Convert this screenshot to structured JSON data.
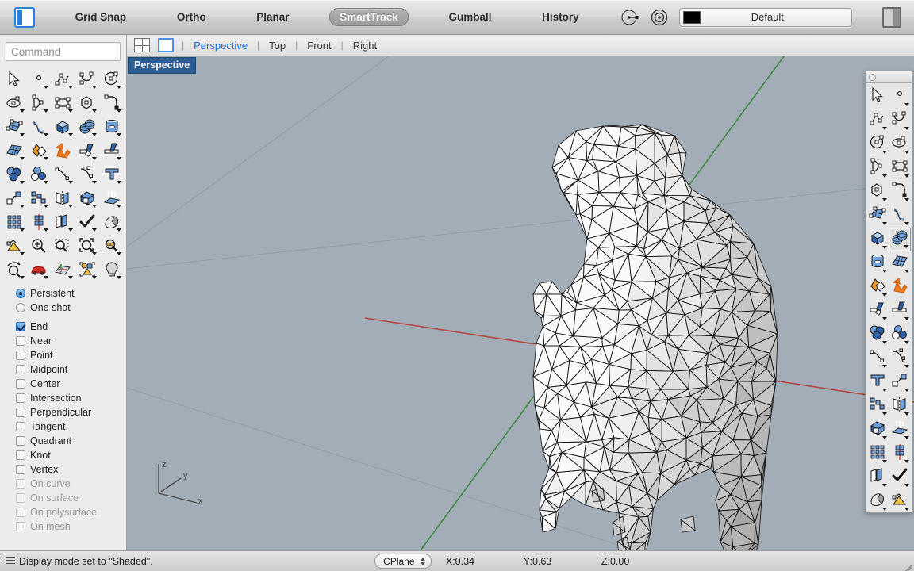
{
  "toolbar": {
    "panel_toggle_left_icon": "left-panel-icon",
    "modes": [
      {
        "label": "Grid Snap",
        "active": false
      },
      {
        "label": "Ortho",
        "active": false
      },
      {
        "label": "Planar",
        "active": false
      },
      {
        "label": "SmartTrack",
        "active": true
      },
      {
        "label": "Gumball",
        "active": false
      },
      {
        "label": "History",
        "active": false
      }
    ],
    "osnap_icon": "osnap-target-icon",
    "record_icon": "record-circle-icon",
    "layer": {
      "name": "Default",
      "swatch_color": "#000000"
    },
    "panel_toggle_right_icon": "right-panel-icon"
  },
  "viewtabs": {
    "four_view_icon": "four-viewport-icon",
    "single_view_icon": "single-viewport-icon",
    "separator": "|",
    "tabs": [
      {
        "label": "Perspective",
        "active": true
      },
      {
        "label": "Top",
        "active": false
      },
      {
        "label": "Front",
        "active": false
      },
      {
        "label": "Right",
        "active": false
      }
    ]
  },
  "command": {
    "value": "",
    "placeholder": "Command"
  },
  "tools": [
    {
      "name": "select-arrow-tool",
      "icon": "cursor-arrow-icon",
      "arrow": false
    },
    {
      "name": "point-tool",
      "icon": "point-icon",
      "arrow": true
    },
    {
      "name": "polyline-tool",
      "icon": "polyline-icon",
      "arrow": true
    },
    {
      "name": "curve-tool",
      "icon": "curve-icon",
      "arrow": true
    },
    {
      "name": "circle-tool",
      "icon": "circle-icon",
      "arrow": true
    },
    {
      "name": "ellipse-tool",
      "icon": "ellipse-icon",
      "arrow": true
    },
    {
      "name": "arc-tool",
      "icon": "arc-icon",
      "arrow": true
    },
    {
      "name": "rectangle-tool",
      "icon": "rectangle-icon",
      "arrow": true
    },
    {
      "name": "polygon-tool",
      "icon": "polygon-icon",
      "arrow": true
    },
    {
      "name": "fillet-curve-tool",
      "icon": "fillet-curve-icon",
      "arrow": true
    },
    {
      "name": "surface-from-curves-tool",
      "icon": "surface-patch-icon",
      "arrow": true
    },
    {
      "name": "extrude-surface-tool",
      "icon": "extrude-surface-icon",
      "arrow": true
    },
    {
      "name": "box-tool",
      "icon": "box-icon",
      "arrow": true
    },
    {
      "name": "sphere-tool",
      "icon": "sphere-icon",
      "arrow": true
    },
    {
      "name": "cylinder-tool",
      "icon": "cylinder-icon",
      "arrow": true
    },
    {
      "name": "mesh-plane-tool",
      "icon": "mesh-plane-icon",
      "arrow": true
    },
    {
      "name": "boolean-union-tool",
      "icon": "boolean-union-icon",
      "arrow": true
    },
    {
      "name": "explode-tool",
      "icon": "explode-icon",
      "arrow": false
    },
    {
      "name": "trim-tool",
      "icon": "trim-icon",
      "arrow": true
    },
    {
      "name": "split-tool",
      "icon": "split-icon",
      "arrow": true
    },
    {
      "name": "boolean-difference-tool",
      "icon": "boolean-difference-icon",
      "arrow": true
    },
    {
      "name": "boolean-intersection-tool",
      "icon": "boolean-intersection-icon",
      "arrow": true
    },
    {
      "name": "offset-curve-tool",
      "icon": "offset-curve-icon",
      "arrow": true
    },
    {
      "name": "blend-curve-tool",
      "icon": "blend-curve-icon",
      "arrow": true
    },
    {
      "name": "text-tool",
      "icon": "text-icon",
      "arrow": true
    },
    {
      "name": "move-tool",
      "icon": "move-icon",
      "arrow": true
    },
    {
      "name": "array-tool",
      "icon": "array-icon",
      "arrow": true
    },
    {
      "name": "mirror-tool",
      "icon": "mirror-icon",
      "arrow": true
    },
    {
      "name": "cap-holes-tool",
      "icon": "cap-solid-icon",
      "arrow": true
    },
    {
      "name": "extrude-direction-tool",
      "icon": "extrude-up-icon",
      "arrow": true
    },
    {
      "name": "rectangular-array-tool",
      "icon": "rect-array-icon",
      "arrow": true
    },
    {
      "name": "polar-array-tool",
      "icon": "polar-array-icon",
      "arrow": true
    },
    {
      "name": "copy-tool",
      "icon": "copy-icon",
      "arrow": true
    },
    {
      "name": "check-tool",
      "icon": "checkmark-icon",
      "arrow": true
    },
    {
      "name": "shade-tool",
      "icon": "shade-object-icon",
      "arrow": true
    },
    {
      "name": "render-tool",
      "icon": "render-icon",
      "arrow": true
    },
    {
      "name": "zoom-in-tool",
      "icon": "zoom-plus-icon",
      "arrow": false
    },
    {
      "name": "zoom-window-tool",
      "icon": "zoom-window-icon",
      "arrow": false
    },
    {
      "name": "zoom-extents-tool",
      "icon": "zoom-extents-icon",
      "arrow": true
    },
    {
      "name": "zoom-selected-tool",
      "icon": "zoom-selected-icon",
      "arrow": true
    },
    {
      "name": "rotate-view-tool",
      "icon": "rotate-view-icon",
      "arrow": true
    },
    {
      "name": "named-view-tool",
      "icon": "car-view-icon",
      "arrow": true
    },
    {
      "name": "cplane-tool",
      "icon": "cplane-grid-icon",
      "arrow": true
    },
    {
      "name": "select-objects-tool",
      "icon": "select-objects-icon",
      "arrow": true
    },
    {
      "name": "light-tool",
      "icon": "light-bulb-icon",
      "arrow": true
    }
  ],
  "osnap": {
    "modes": [
      {
        "label": "Persistent",
        "type": "radio",
        "checked": true,
        "disabled": false
      },
      {
        "label": "One shot",
        "type": "radio",
        "checked": false,
        "disabled": false
      }
    ],
    "items": [
      {
        "label": "End",
        "checked": true,
        "disabled": false
      },
      {
        "label": "Near",
        "checked": false,
        "disabled": false
      },
      {
        "label": "Point",
        "checked": false,
        "disabled": false
      },
      {
        "label": "Midpoint",
        "checked": false,
        "disabled": false
      },
      {
        "label": "Center",
        "checked": false,
        "disabled": false
      },
      {
        "label": "Intersection",
        "checked": false,
        "disabled": false
      },
      {
        "label": "Perpendicular",
        "checked": false,
        "disabled": false
      },
      {
        "label": "Tangent",
        "checked": false,
        "disabled": false
      },
      {
        "label": "Quadrant",
        "checked": false,
        "disabled": false
      },
      {
        "label": "Knot",
        "checked": false,
        "disabled": false
      },
      {
        "label": "Vertex",
        "checked": false,
        "disabled": false
      },
      {
        "label": "On curve",
        "checked": false,
        "disabled": true
      },
      {
        "label": "On surface",
        "checked": false,
        "disabled": true
      },
      {
        "label": "On polysurface",
        "checked": false,
        "disabled": true
      },
      {
        "label": "On mesh",
        "checked": false,
        "disabled": true
      }
    ]
  },
  "viewport": {
    "label": "Perspective",
    "background_color": "#a3adb8",
    "grid_line_color": "#8e99a4",
    "x_axis_color": "#b5483f",
    "y_axis_color": "#3b8a3f",
    "model": {
      "name": "triangulated-mesh-model",
      "shading": "Shaded",
      "wireframe_color": "#111111",
      "surface_light": "#f2f2f2",
      "surface_dark": "#8e8e8e"
    },
    "axis_gizmo": {
      "x_label": "x",
      "y_label": "y",
      "z_label": "z"
    }
  },
  "right_palette": {
    "title_close_icon": "close-dot-icon",
    "tools": [
      {
        "name": "select-arrow-tool",
        "icon": "cursor-arrow-icon",
        "arrow": false,
        "selected": false
      },
      {
        "name": "point-tool",
        "icon": "point-icon",
        "arrow": true,
        "selected": false
      },
      {
        "name": "polyline-tool",
        "icon": "polyline-icon",
        "arrow": true,
        "selected": false
      },
      {
        "name": "curve-tool",
        "icon": "curve-icon",
        "arrow": true,
        "selected": false
      },
      {
        "name": "circle-tool",
        "icon": "circle-icon",
        "arrow": true,
        "selected": false
      },
      {
        "name": "ellipse-tool",
        "icon": "ellipse-icon",
        "arrow": true,
        "selected": false
      },
      {
        "name": "arc-tool",
        "icon": "arc-icon",
        "arrow": true,
        "selected": false
      },
      {
        "name": "rectangle-tool",
        "icon": "rectangle-icon",
        "arrow": true,
        "selected": false
      },
      {
        "name": "polygon-tool",
        "icon": "polygon-icon",
        "arrow": true,
        "selected": false
      },
      {
        "name": "fillet-curve-tool",
        "icon": "fillet-curve-icon",
        "arrow": true,
        "selected": false
      },
      {
        "name": "surface-from-curves-tool",
        "icon": "surface-patch-icon",
        "arrow": true,
        "selected": false
      },
      {
        "name": "extrude-surface-tool",
        "icon": "extrude-surface-icon",
        "arrow": true,
        "selected": false
      },
      {
        "name": "box-tool",
        "icon": "box-icon",
        "arrow": true,
        "selected": false
      },
      {
        "name": "sphere-tool",
        "icon": "sphere-icon",
        "arrow": true,
        "selected": true
      },
      {
        "name": "cylinder-tool",
        "icon": "cylinder-icon",
        "arrow": true,
        "selected": false
      },
      {
        "name": "mesh-plane-tool",
        "icon": "mesh-plane-icon",
        "arrow": true,
        "selected": false
      },
      {
        "name": "boolean-union-tool",
        "icon": "boolean-union-icon",
        "arrow": true,
        "selected": false
      },
      {
        "name": "explode-tool",
        "icon": "explode-icon",
        "arrow": false,
        "selected": false
      },
      {
        "name": "trim-tool",
        "icon": "trim-icon",
        "arrow": true,
        "selected": false
      },
      {
        "name": "split-tool",
        "icon": "split-icon",
        "arrow": true,
        "selected": false
      },
      {
        "name": "boolean-difference-tool",
        "icon": "boolean-difference-icon",
        "arrow": true,
        "selected": false
      },
      {
        "name": "boolean-intersection-tool",
        "icon": "boolean-intersection-icon",
        "arrow": true,
        "selected": false
      },
      {
        "name": "offset-curve-tool",
        "icon": "offset-curve-icon",
        "arrow": true,
        "selected": false
      },
      {
        "name": "blend-curve-tool",
        "icon": "blend-curve-icon",
        "arrow": true,
        "selected": false
      },
      {
        "name": "text-tool",
        "icon": "text-icon",
        "arrow": true,
        "selected": false
      },
      {
        "name": "move-tool",
        "icon": "move-icon",
        "arrow": true,
        "selected": false
      },
      {
        "name": "array-tool",
        "icon": "array-icon",
        "arrow": true,
        "selected": false
      },
      {
        "name": "mirror-tool",
        "icon": "mirror-icon",
        "arrow": true,
        "selected": false
      },
      {
        "name": "cap-holes-tool",
        "icon": "cap-solid-icon",
        "arrow": true,
        "selected": false
      },
      {
        "name": "extrude-direction-tool",
        "icon": "extrude-up-icon",
        "arrow": true,
        "selected": false
      },
      {
        "name": "rectangular-array-tool",
        "icon": "rect-array-icon",
        "arrow": true,
        "selected": false
      },
      {
        "name": "polar-array-tool",
        "icon": "polar-array-icon",
        "arrow": true,
        "selected": false
      },
      {
        "name": "copy-tool",
        "icon": "copy-icon",
        "arrow": true,
        "selected": false
      },
      {
        "name": "check-tool",
        "icon": "checkmark-icon",
        "arrow": true,
        "selected": false
      },
      {
        "name": "shade-tool",
        "icon": "shade-object-icon",
        "arrow": true,
        "selected": false
      },
      {
        "name": "render-tool",
        "icon": "render-icon",
        "arrow": true,
        "selected": false
      }
    ]
  },
  "statusbar": {
    "menu_icon": "hamburger-icon",
    "message": "Display mode set to \"Shaded\".",
    "cplane_label": "CPlane",
    "coords": [
      {
        "label": "X:",
        "value": "0.34"
      },
      {
        "label": "Y:",
        "value": "0.63"
      },
      {
        "label": "Z:",
        "value": "0.00"
      }
    ],
    "resize_icon": "resize-grip-icon"
  }
}
